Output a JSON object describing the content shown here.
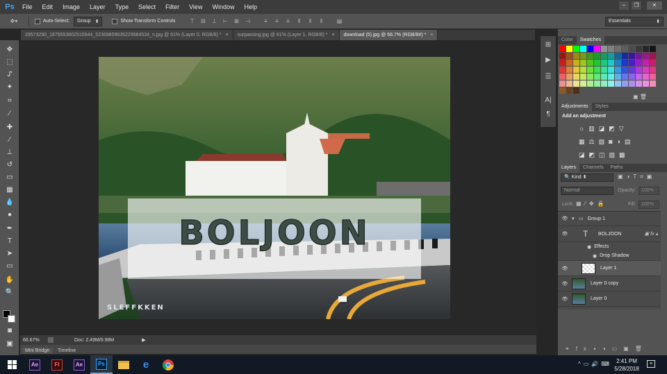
{
  "menubar": {
    "app_logo": "Ps",
    "items": [
      "File",
      "Edit",
      "Image",
      "Layer",
      "Type",
      "Select",
      "Filter",
      "View",
      "Window",
      "Help"
    ]
  },
  "options_bar": {
    "auto_select_label": "Auto-Select:",
    "auto_select_value": "Group",
    "show_transform_label": "Show Transform Controls",
    "workspace_value": "Essentials"
  },
  "tabs": [
    {
      "label": "29573290_1875593602515944_52369859635229984534_n.jpg @ 61% (Layer 0, RGB/8) *",
      "active": false
    },
    {
      "label": "surpassing.jpg @ 61% (Layer 1, RGB/8) *",
      "active": false
    },
    {
      "label": "download (5).jpg @ 66.7% (RGB/8#) *",
      "active": true
    }
  ],
  "canvas": {
    "text_overlay": "BOLJOON",
    "watermark": "SLEFFKKEN"
  },
  "status": {
    "zoom": "66.67%",
    "doc": "Doc: 2.49M/9.98M"
  },
  "bridge": {
    "tabs": [
      "Mini Bridge",
      "Timeline"
    ]
  },
  "color_panel": {
    "tabs": [
      "Color",
      "Swatches"
    ],
    "active": "Swatches"
  },
  "adjustments_panel": {
    "tabs": [
      "Adjustments",
      "Styles"
    ],
    "title": "Add an adjustment"
  },
  "layers_panel": {
    "tabs": [
      "Layers",
      "Channels",
      "Paths"
    ],
    "kind_label": "Kind",
    "blend_mode": "Normal",
    "opacity_label": "Opacity:",
    "opacity_value": "100%",
    "lock_label": "Lock:",
    "fill_label": "Fill:",
    "fill_value": "100%",
    "layers": [
      {
        "name": "Group 1",
        "type": "group"
      },
      {
        "name": "BOLJOON",
        "type": "text"
      },
      {
        "name": "Effects",
        "type": "effects"
      },
      {
        "name": "Drop Shadow",
        "type": "effect"
      },
      {
        "name": "Layer 1",
        "type": "pixel"
      },
      {
        "name": "Layer 0 copy",
        "type": "pixel"
      },
      {
        "name": "Layer 0",
        "type": "pixel"
      }
    ]
  },
  "taskbar": {
    "time": "2:41 PM",
    "date": "5/28/2018",
    "apps": [
      {
        "label": "Ae",
        "icon": "after-effects-icon"
      },
      {
        "label": "Fl",
        "icon": "flash-icon"
      },
      {
        "label": "Ae",
        "icon": "after-effects-icon"
      },
      {
        "label": "Ps",
        "icon": "photoshop-icon"
      },
      {
        "label": "",
        "icon": "file-explorer-icon"
      },
      {
        "label": "",
        "icon": "edge-icon"
      },
      {
        "label": "",
        "icon": "chrome-icon"
      }
    ]
  },
  "colors": {
    "accent": "#4aa3e8",
    "panel_bg": "#535353",
    "workspace_bg": "#282828"
  }
}
